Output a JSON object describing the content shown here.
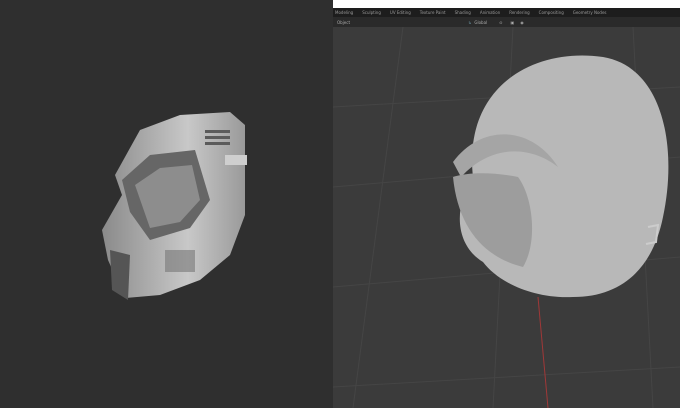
{
  "workspace_tabs": [
    "Modeling",
    "Sculpting",
    "UV Editing",
    "Texture Paint",
    "Shading",
    "Animation",
    "Rendering",
    "Compositing",
    "Geometry Nodes"
  ],
  "header": {
    "mode": "Object",
    "orientation": "Global"
  },
  "colors": {
    "left_bg": "#2f2f2f",
    "viewport_bg": "#3b3b3b",
    "model": "#b5b5b5",
    "x_axis": "#a03838"
  }
}
